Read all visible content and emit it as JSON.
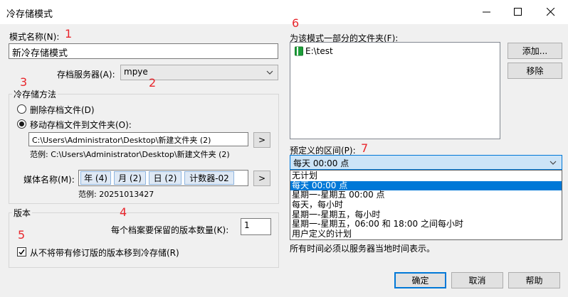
{
  "window": {
    "title": "冷存储模式"
  },
  "annotations": [
    "1",
    "2",
    "3",
    "4",
    "5",
    "6",
    "7"
  ],
  "mode_name": {
    "label": "模式名称(N):",
    "value": "新冷存储模式"
  },
  "archive_server": {
    "label": "存档服务器(A):",
    "value": "mpye"
  },
  "cold_method": {
    "legend": "冷存储方法",
    "delete_label": "删除存档文件(D)",
    "move_label": "移动存档文件到文件夹(O):",
    "path_value": "C:\\Users\\Administrator\\Desktop\\新建文件夹 (2)",
    "browse_label": ">",
    "path_example": "范例: C:\\Users\\Administrator\\Desktop\\新建文件夹 (2)",
    "media_label": "媒体名称(M):",
    "media_tokens": [
      "年 (4)",
      "月 (2)",
      "日 (2)",
      "计数器-02"
    ],
    "media_browse_label": ">",
    "media_example": "范例: 20251013427"
  },
  "version": {
    "legend": "版本",
    "count_label": "每个档案要保留的版本数量(K):",
    "count_value": "1",
    "never_move_label": "从不将带有修订版的版本移到冷存储(R)"
  },
  "folders": {
    "label": "为该模式一部分的文件夹(F):",
    "items": [
      "E:\\test"
    ],
    "add_label": "添加...",
    "remove_label": "移除"
  },
  "interval": {
    "label": "预定义的区间(P):",
    "value": "每天 00:00 点",
    "options": [
      "无计划",
      "每天 00:00 点",
      "星期一-星期五 00:00 点",
      "每天，每小时",
      "星期一-星期五，每小时",
      "星期一-星期五，06:00 和 18:00 之间每小时",
      "用户定义的计划"
    ],
    "note": "所有时间必须以服务器当地时间表示。"
  },
  "buttons": {
    "ok": "确定",
    "cancel": "取消",
    "help": "帮助"
  },
  "colors": {
    "selection": "#0078d7",
    "annotation": "#e8262c",
    "folder_icon": "#1e9e3a"
  }
}
